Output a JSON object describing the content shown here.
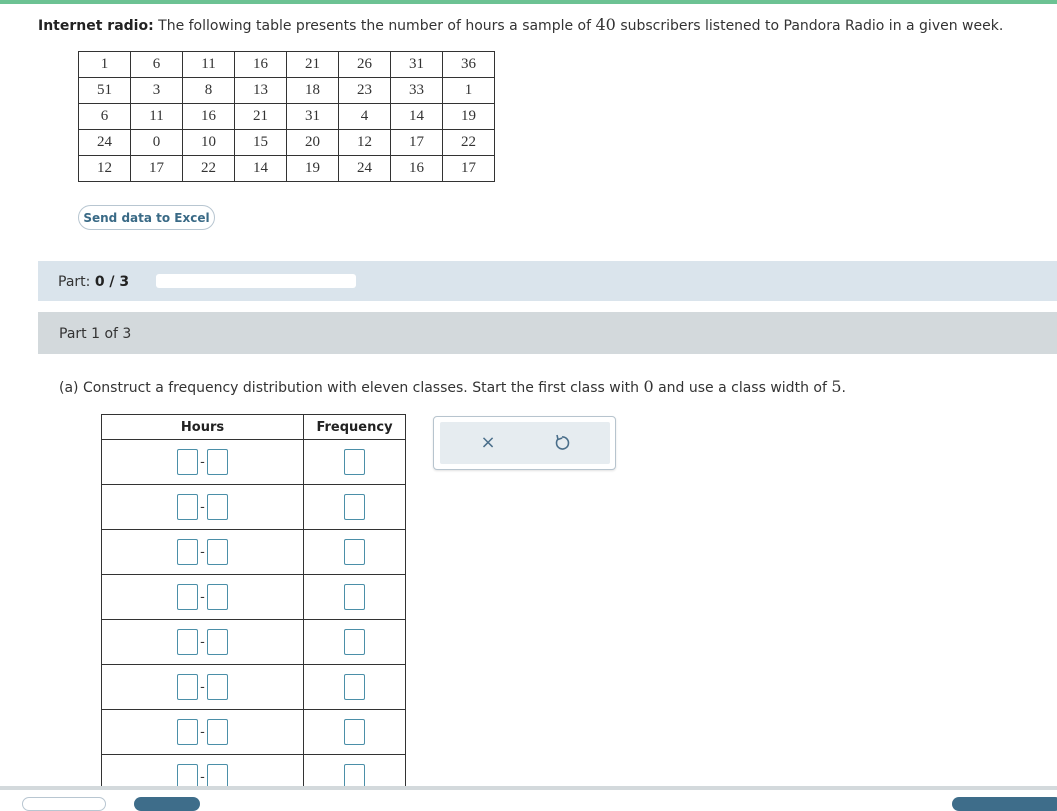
{
  "problem": {
    "title": "Internet radio:",
    "text_before": "The following table presents the number of hours a sample of",
    "count": "40",
    "text_after": "subscribers listened to Pandora Radio in a given week."
  },
  "data_table": [
    [
      "1",
      "6",
      "11",
      "16",
      "21",
      "26",
      "31",
      "36"
    ],
    [
      "51",
      "3",
      "8",
      "13",
      "18",
      "23",
      "33",
      "1"
    ],
    [
      "6",
      "11",
      "16",
      "21",
      "31",
      "4",
      "14",
      "19"
    ],
    [
      "24",
      "0",
      "10",
      "15",
      "20",
      "12",
      "17",
      "22"
    ],
    [
      "12",
      "17",
      "22",
      "14",
      "19",
      "24",
      "16",
      "17"
    ]
  ],
  "excel_button": "Send data to Excel",
  "part_progress": {
    "label": "Part:",
    "score": "0 / 3",
    "fraction": 0
  },
  "part_header": "Part 1 of 3",
  "question": {
    "prefix": "(a) Construct a frequency distribution with eleven classes. Start the first class with",
    "start_value": "0",
    "middle": "and use a class width of",
    "width_value": "5",
    "suffix": "."
  },
  "freq_table": {
    "headers": [
      "Hours",
      "Frequency"
    ],
    "separator": "-"
  },
  "tools": {
    "clear_icon": "close-icon",
    "undo_icon": "undo-icon"
  },
  "colors": {
    "accent_green": "#6cc293",
    "input_border": "#4b8fa8",
    "part_bar": "#dae4ec",
    "part1_bar": "#d3d9dc"
  }
}
